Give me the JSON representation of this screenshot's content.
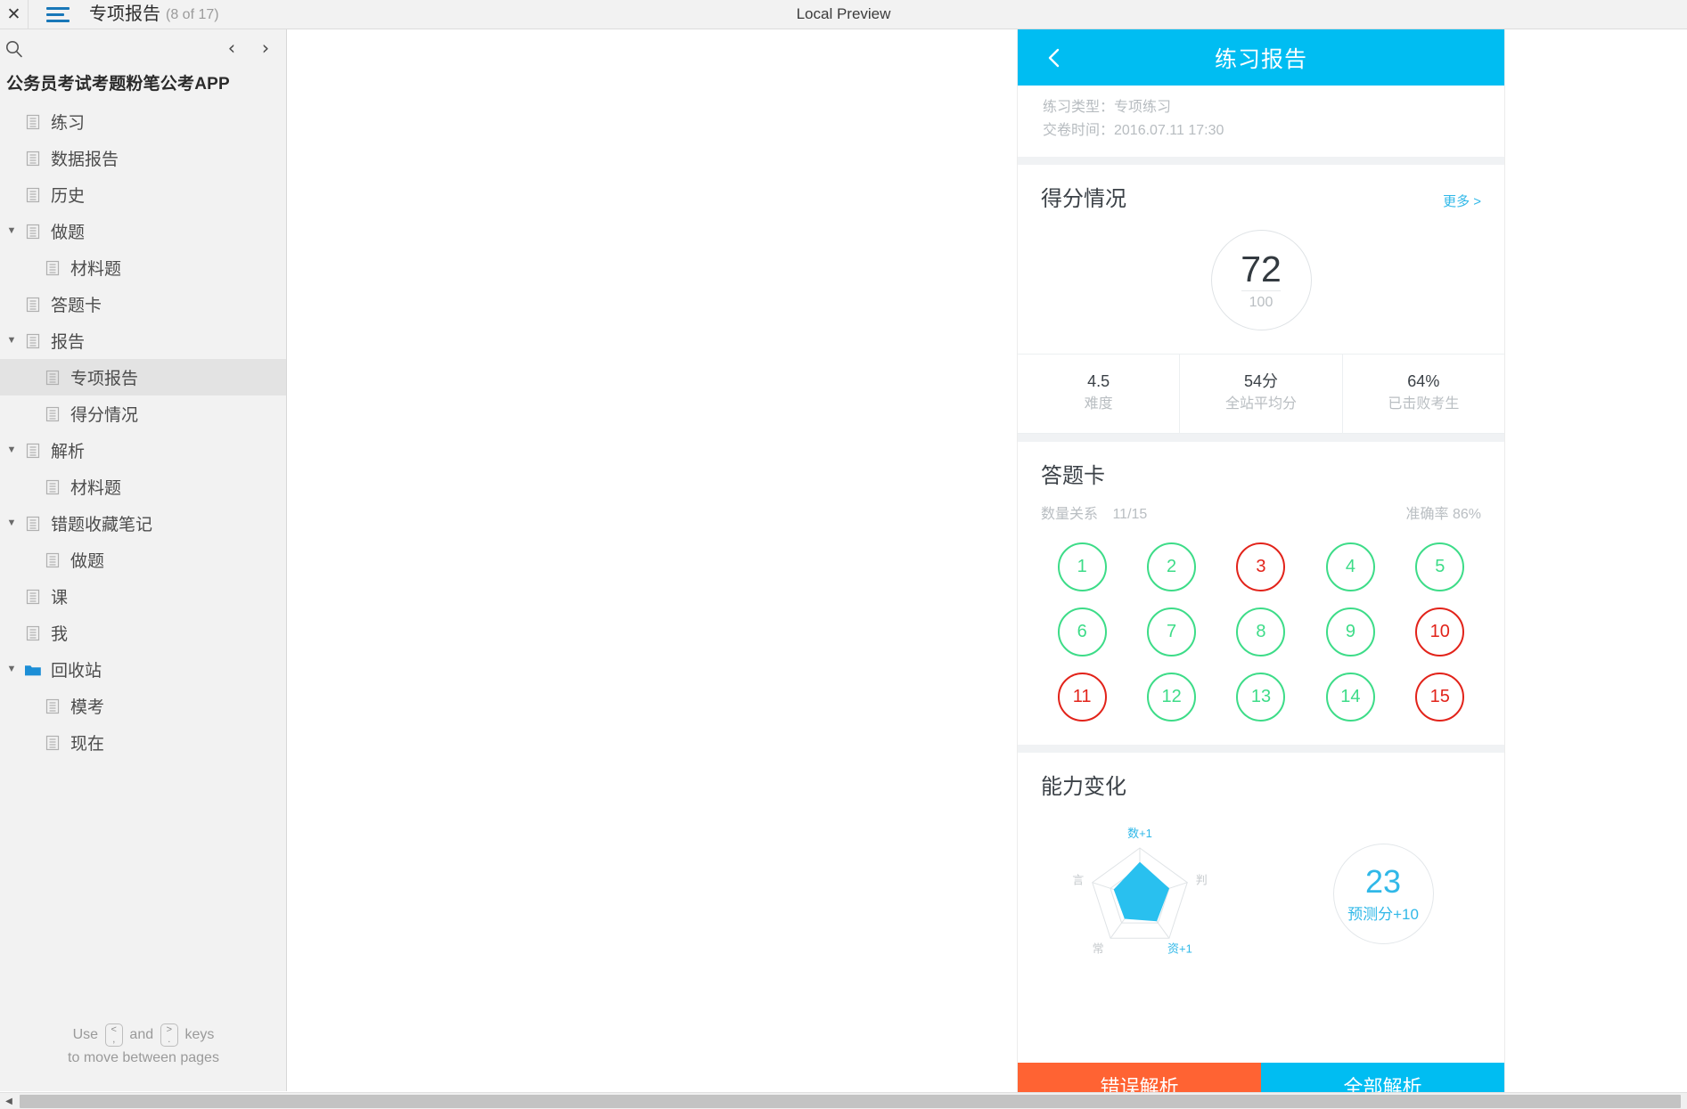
{
  "topbar": {
    "close_icon": "close-icon",
    "menu_icon": "hamburger-menu-icon",
    "doc_title": "专项报告",
    "page_count": "(8 of 17)",
    "app_title": "Local Preview"
  },
  "sidebar": {
    "search_icon": "search-icon",
    "prev_label": "‹",
    "next_label": "›",
    "project_title": "公务员考试考题粉笔公考APP",
    "tree": [
      {
        "label": "练习",
        "depth": 0,
        "arrow": "",
        "icon": "page-icon",
        "selected": false
      },
      {
        "label": "数据报告",
        "depth": 0,
        "arrow": "",
        "icon": "page-icon",
        "selected": false
      },
      {
        "label": "历史",
        "depth": 0,
        "arrow": "",
        "icon": "page-icon",
        "selected": false
      },
      {
        "label": "做题",
        "depth": 0,
        "arrow": "▼",
        "icon": "page-icon",
        "selected": false
      },
      {
        "label": "材料题",
        "depth": 1,
        "arrow": "",
        "icon": "page-icon",
        "selected": false
      },
      {
        "label": "答题卡",
        "depth": 0,
        "arrow": "",
        "icon": "page-icon",
        "selected": false
      },
      {
        "label": "报告",
        "depth": 0,
        "arrow": "▼",
        "icon": "page-icon",
        "selected": false
      },
      {
        "label": "专项报告",
        "depth": 1,
        "arrow": "",
        "icon": "page-icon",
        "selected": true
      },
      {
        "label": "得分情况",
        "depth": 1,
        "arrow": "",
        "icon": "page-icon",
        "selected": false
      },
      {
        "label": "解析",
        "depth": 0,
        "arrow": "▼",
        "icon": "page-icon",
        "selected": false
      },
      {
        "label": "材料题",
        "depth": 1,
        "arrow": "",
        "icon": "page-icon",
        "selected": false
      },
      {
        "label": "错题收藏笔记",
        "depth": 0,
        "arrow": "▼",
        "icon": "page-icon",
        "selected": false
      },
      {
        "label": "做题",
        "depth": 1,
        "arrow": "",
        "icon": "page-icon",
        "selected": false
      },
      {
        "label": "课",
        "depth": 0,
        "arrow": "",
        "icon": "page-icon",
        "selected": false
      },
      {
        "label": "我",
        "depth": 0,
        "arrow": "",
        "icon": "page-icon",
        "selected": false
      },
      {
        "label": "回收站",
        "depth": 0,
        "arrow": "▼",
        "icon": "folder-icon",
        "selected": false
      },
      {
        "label": "模考",
        "depth": 1,
        "arrow": "",
        "icon": "page-icon",
        "selected": false
      },
      {
        "label": "现在",
        "depth": 1,
        "arrow": "",
        "icon": "page-icon",
        "selected": false
      }
    ],
    "hint_pre": "Use",
    "hint_key1_top": "<",
    "hint_key1_bottom": ",",
    "hint_and": "and",
    "hint_key2_top": ">",
    "hint_key2_bottom": ".",
    "hint_post": "keys",
    "hint_line2": "to move between pages"
  },
  "phone": {
    "header": {
      "back_icon": "chevron-left-icon",
      "title": "练习报告"
    },
    "meta": {
      "type_line": "练习类型：专项练习",
      "time_line": "交卷时间：2016.07.11 17:30"
    },
    "score_card": {
      "title": "得分情况",
      "more_label": "更多 >",
      "score": "72",
      "total": "100"
    },
    "stats": [
      {
        "value": "4.5",
        "label": "难度"
      },
      {
        "value": "54分",
        "label": "全站平均分"
      },
      {
        "value": "64%",
        "label": "已击败考生"
      }
    ],
    "answer_card": {
      "title": "答题卡",
      "category": "数量关系",
      "progress": "11/15",
      "accuracy": "准确率 86%",
      "bubbles": [
        {
          "n": "1",
          "state": "correct"
        },
        {
          "n": "2",
          "state": "correct"
        },
        {
          "n": "3",
          "state": "wrong"
        },
        {
          "n": "4",
          "state": "correct"
        },
        {
          "n": "5",
          "state": "correct"
        },
        {
          "n": "6",
          "state": "correct"
        },
        {
          "n": "7",
          "state": "correct"
        },
        {
          "n": "8",
          "state": "correct"
        },
        {
          "n": "9",
          "state": "correct"
        },
        {
          "n": "10",
          "state": "wrong"
        },
        {
          "n": "11",
          "state": "wrong"
        },
        {
          "n": "12",
          "state": "correct"
        },
        {
          "n": "13",
          "state": "correct"
        },
        {
          "n": "14",
          "state": "correct"
        },
        {
          "n": "15",
          "state": "wrong"
        }
      ]
    },
    "ability": {
      "title": "能力变化",
      "predict_value": "23",
      "predict_label": "预测分+10"
    },
    "footer": {
      "wrong_label": "错误解析",
      "all_label": "全部解析"
    }
  },
  "colors": {
    "brand_blue": "#00bdf2",
    "link_blue": "#30b8e8",
    "correct_green": "#3ddc88",
    "wrong_red": "#e2231a",
    "orange": "#ff6333",
    "chrome_gray": "#f2f2f2"
  },
  "chart_data": {
    "type": "radar",
    "title": "能力变化",
    "categories": [
      "数",
      "判",
      "资",
      "常",
      "言"
    ],
    "tick_labels": [
      "数+1",
      "判",
      "资+1",
      "常",
      "言"
    ],
    "values": [
      0.72,
      0.62,
      0.58,
      0.52,
      0.55
    ],
    "rmax": 1.0,
    "rings": 2,
    "fill_color": "#29c0ef",
    "grid_color": "#dfe3e6",
    "label_colors": [
      "#30b8e8",
      "#c6cacd",
      "#30b8e8",
      "#c6cacd",
      "#c6cacd"
    ],
    "legend": "none"
  }
}
